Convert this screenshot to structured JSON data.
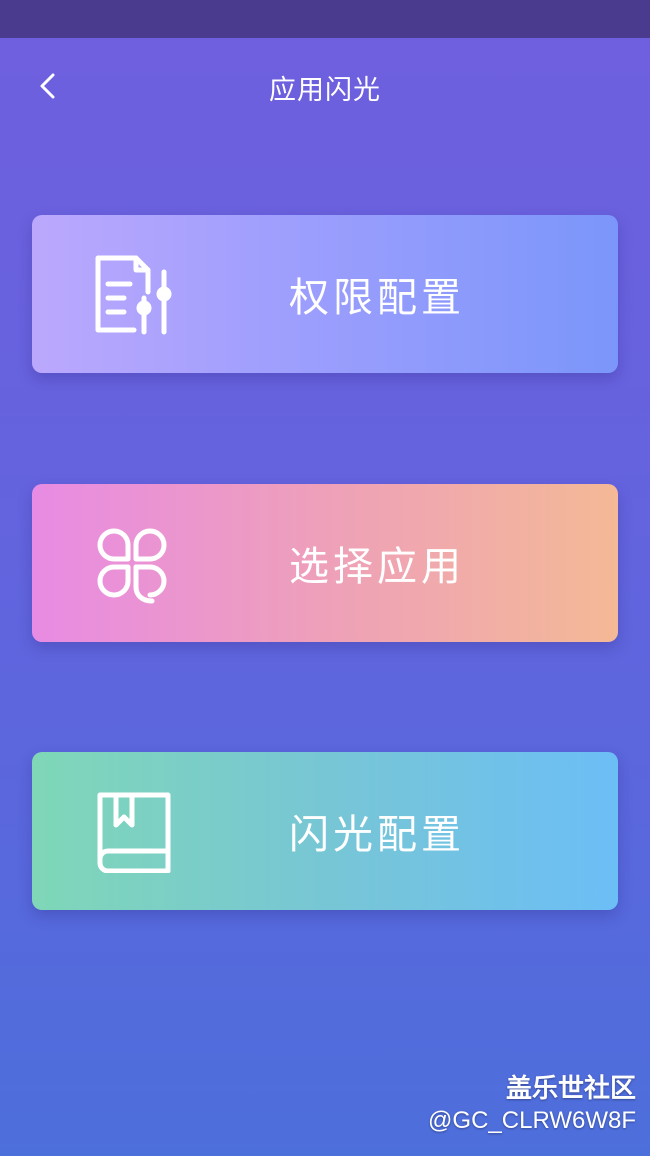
{
  "header": {
    "title": "应用闪光",
    "back_icon": "chevron-left-icon"
  },
  "menu": [
    {
      "label": "权限配置",
      "icon": "document-sliders-icon",
      "colors": [
        "#bba8fd",
        "#7b96fa"
      ]
    },
    {
      "label": "选择应用",
      "icon": "clover-icon",
      "colors": [
        "#e88be4",
        "#f4b996"
      ]
    },
    {
      "label": "闪光配置",
      "icon": "bookmark-book-icon",
      "colors": [
        "#7fd7b7",
        "#6cbef6"
      ]
    }
  ],
  "watermark": {
    "brand": "盖乐世社区",
    "user": "@GC_CLRW6W8F"
  }
}
